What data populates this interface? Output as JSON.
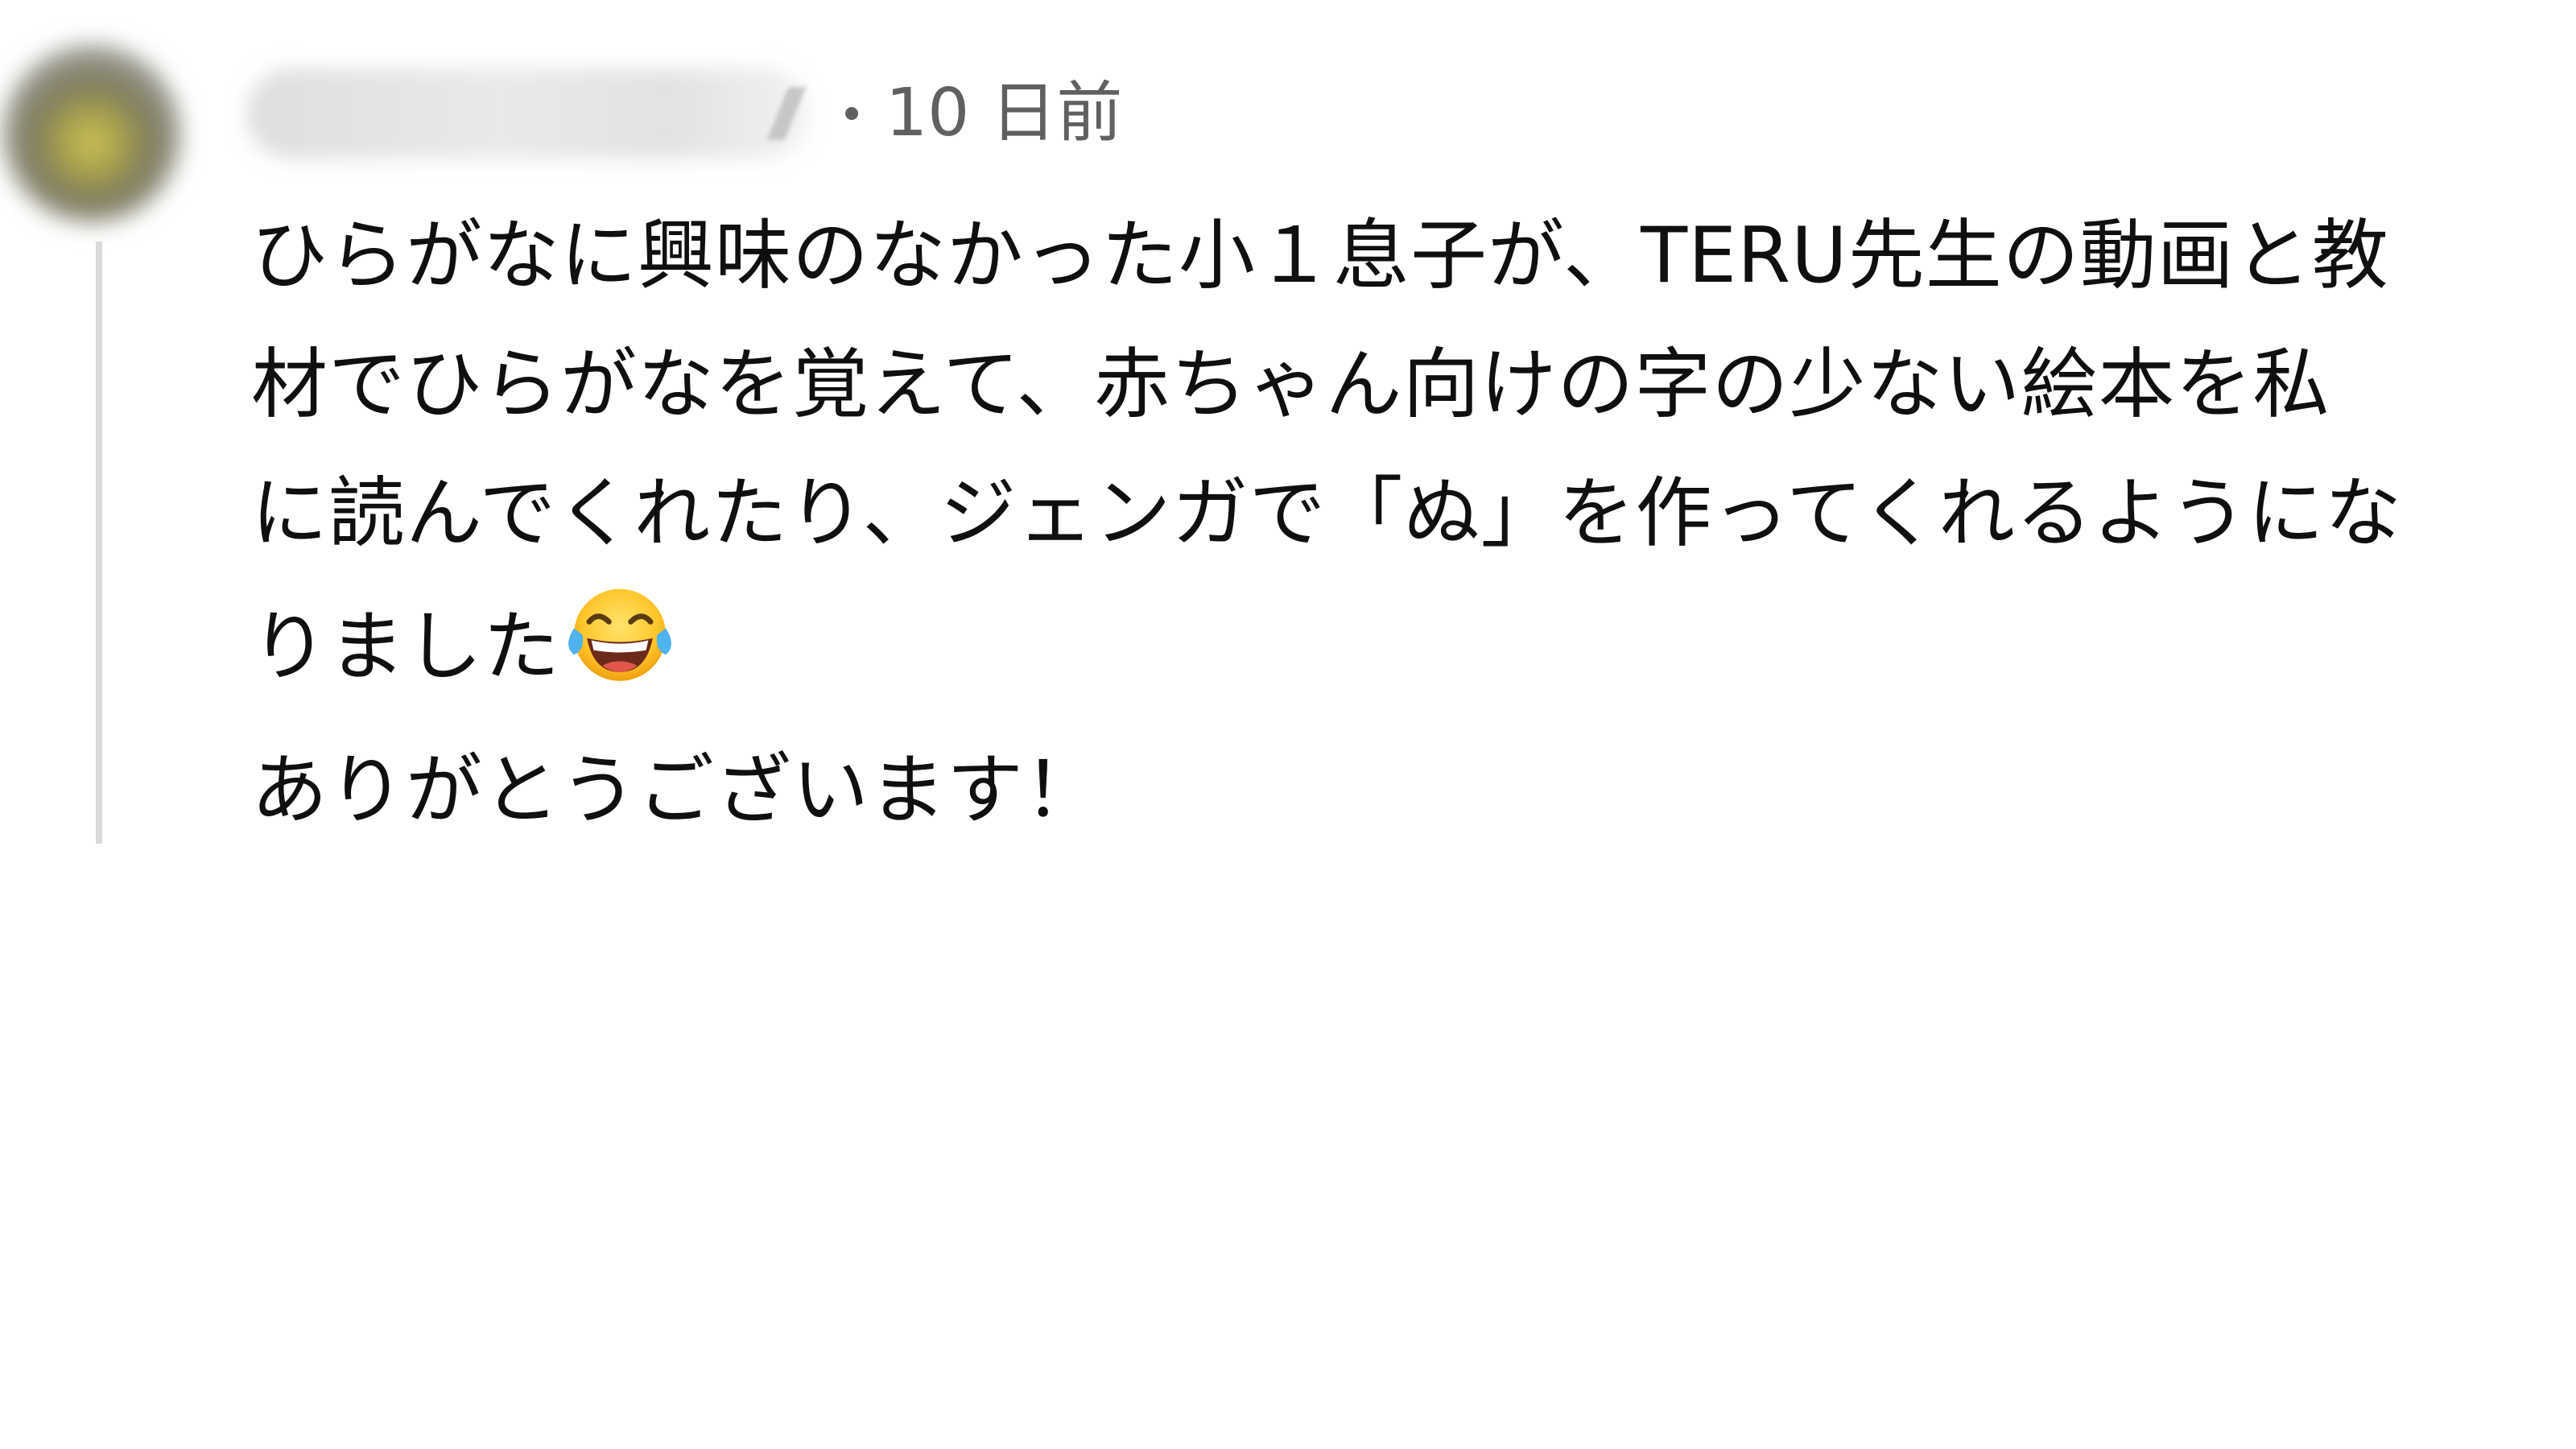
{
  "comment": {
    "timestamp": "10 日前",
    "body_lines": [
      "ひらがなに興味のなかった小１息子が、TERU先生の動画と教",
      "材でひらがなを覚えて、赤ちゃん向けの字の少ない絵本を私",
      "に読んでくれたり、ジェンガで「ぬ」を作ってくれるようにな",
      "りました",
      "ありがとうございます！"
    ],
    "emoji": "face-with-tears-of-joy",
    "avatar_icon": "user-avatar-blurred"
  }
}
